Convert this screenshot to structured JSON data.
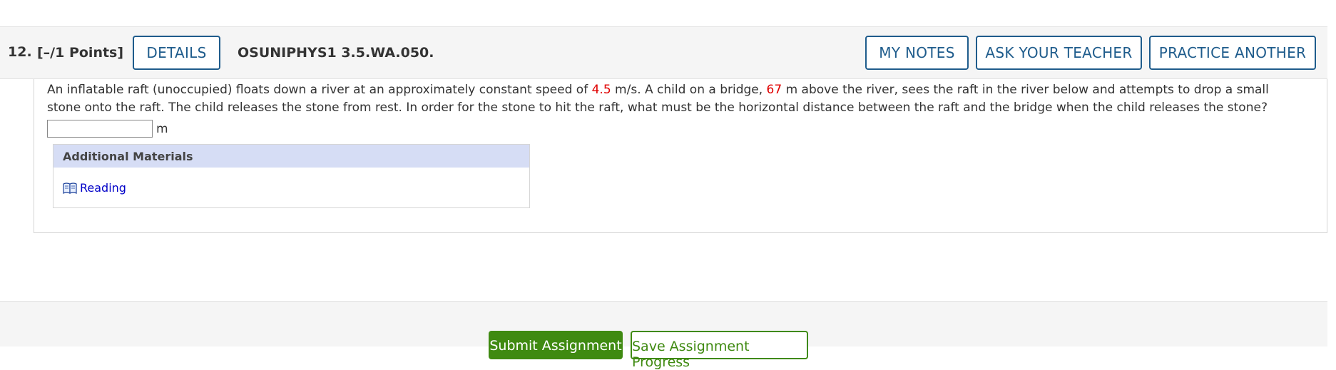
{
  "question": {
    "number": "12.",
    "points": "[–/1 Points]",
    "details_label": "DETAILS",
    "code": "OSUNIPHYS1 3.5.WA.050.",
    "my_notes_label": "MY NOTES",
    "ask_teacher_label": "ASK YOUR TEACHER",
    "practice_label": "PRACTICE ANOTHER",
    "text_part1": "An inflatable raft (unoccupied) floats down a river at an approximately constant speed of ",
    "speed": "4.5",
    "text_part2": " m/s. A child on a bridge, ",
    "height": "67",
    "text_part3": " m above the river, sees the raft in the river below and attempts to drop a small stone onto the raft. The child releases the stone from rest. In order for the stone to hit the raft, what must be the horizontal distance between the raft and the bridge when the child releases the stone?",
    "answer_value": "",
    "answer_unit": "m"
  },
  "materials": {
    "title": "Additional Materials",
    "items": [
      {
        "label": "Reading",
        "icon": "book-icon"
      }
    ]
  },
  "footer": {
    "submit_label": "Submit Assignment",
    "save_label": "Save Assignment Progress"
  },
  "colors": {
    "accent": "#1f5c8c",
    "highlight": "#e00000",
    "submit": "#3f8a11",
    "materials_header": "#d6ddf5",
    "link": "#0000c8"
  }
}
